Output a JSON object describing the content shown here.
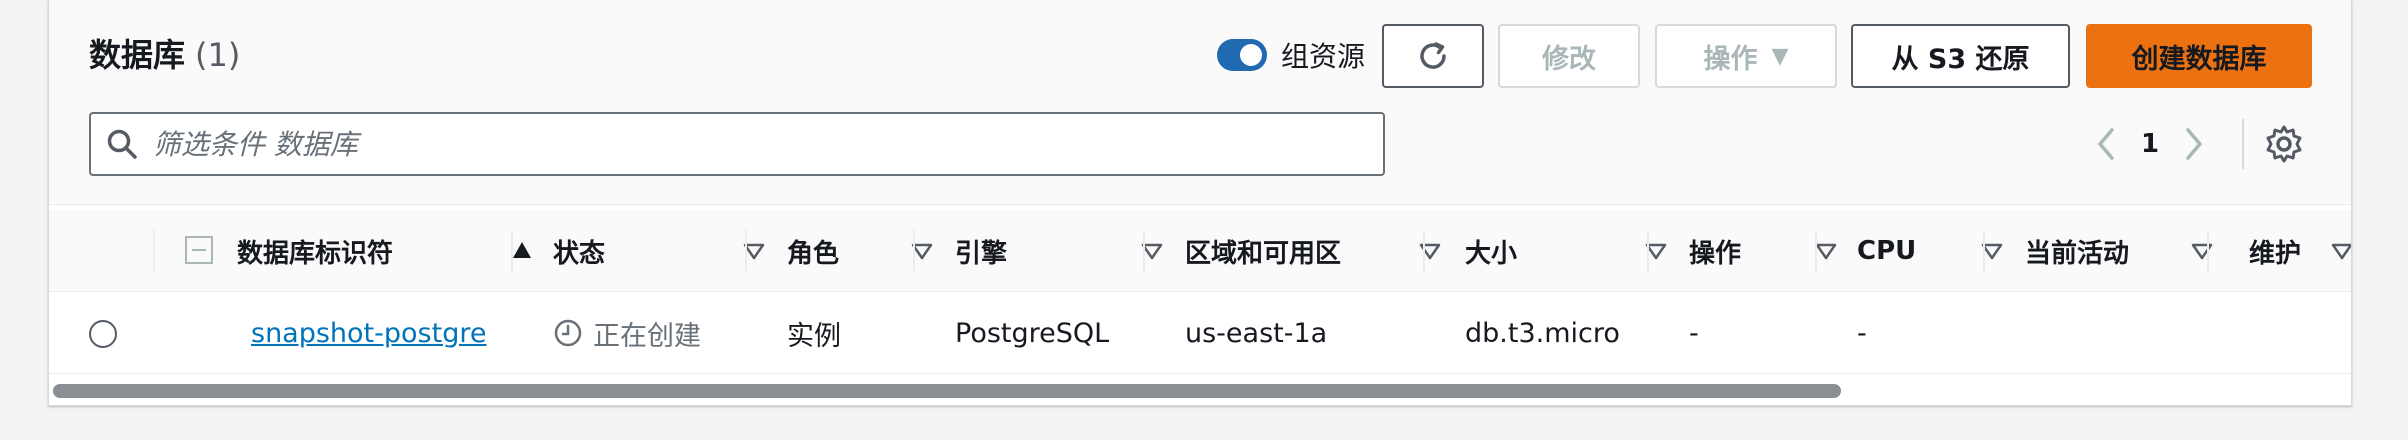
{
  "header": {
    "title": "数据库",
    "count": "(1)"
  },
  "toolbar": {
    "group_toggle_label": "组资源",
    "group_toggle_on": true,
    "refresh_icon": "refresh-icon",
    "modify_label": "修改",
    "actions_label": "操作",
    "restore_s3_label": "从 S3 还原",
    "create_label": "创建数据库"
  },
  "search": {
    "placeholder": "筛选条件 数据库",
    "value": ""
  },
  "pagination": {
    "current_page": "1"
  },
  "table": {
    "columns": [
      {
        "label": "数据库标识符",
        "sort": "ascending"
      },
      {
        "label": "状态"
      },
      {
        "label": "角色"
      },
      {
        "label": "引擎"
      },
      {
        "label": "区域和可用区"
      },
      {
        "label": "大小"
      },
      {
        "label": "操作"
      },
      {
        "label": "CPU"
      },
      {
        "label": "当前活动"
      },
      {
        "label": "维护"
      }
    ],
    "rows": [
      {
        "identifier": "snapshot-postgre",
        "status": "正在创建",
        "role": "实例",
        "engine": "PostgreSQL",
        "region_az": "us-east-1a",
        "size": "db.t3.micro",
        "actions": "-",
        "cpu": "-"
      }
    ]
  },
  "colors": {
    "accent_orange": "#ec7211",
    "link_blue": "#0073bb",
    "toggle_blue": "#1f6ab0"
  }
}
